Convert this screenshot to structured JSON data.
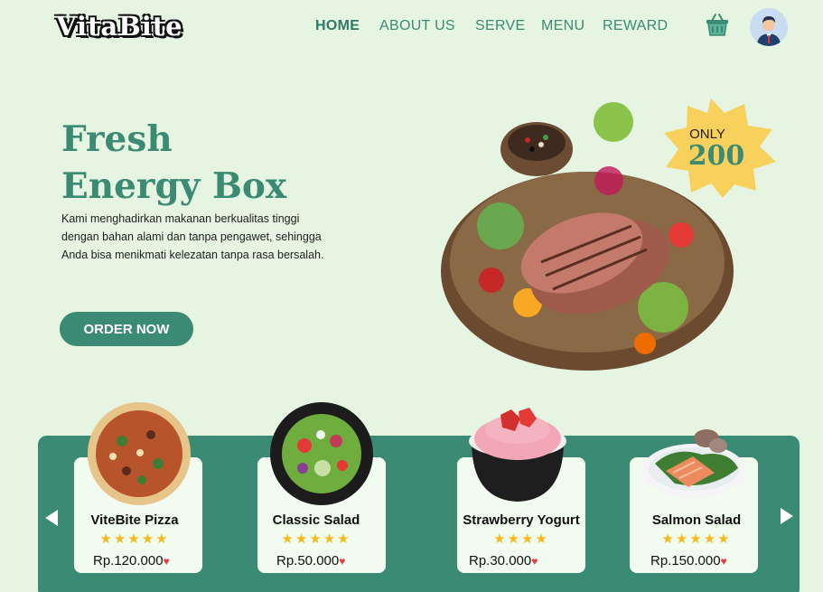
{
  "brand": {
    "logo_text": "VitaBite"
  },
  "nav": {
    "items": [
      "HOME",
      "ABOUT US",
      "SERVE",
      "MENU",
      "REWARD"
    ],
    "active": "HOME"
  },
  "icons": {
    "cart": "shopping-basket-icon",
    "user": "user-avatar-icon",
    "prev": "arrow-left-icon",
    "next": "arrow-right-icon",
    "heart": "heart-icon",
    "star": "star-icon"
  },
  "hero": {
    "title_line1": "Fresh",
    "title_line2": "Energy Box",
    "description": "Kami menghadirkan makanan berkualitas tinggi dengan bahan alami dan tanpa pengawet, sehingga Anda bisa menikmati kelezatan tanpa rasa bersalah.",
    "cta_label": "ORDER NOW",
    "badge_only": "ONLY",
    "badge_number": "200"
  },
  "products": [
    {
      "name": "ViteBite Pizza",
      "rating": 5,
      "stars": "★★★★★",
      "price": "Rp.120.000"
    },
    {
      "name": "Classic Salad",
      "rating": 5,
      "stars": "★★★★★",
      "price": "Rp.50.000"
    },
    {
      "name": "Strawberry Yogurt",
      "rating": 4,
      "stars": "★★★★",
      "price": "Rp.30.000"
    },
    {
      "name": "Salmon Salad",
      "rating": 5,
      "stars": "★★★★★",
      "price": "Rp.150.000"
    }
  ],
  "colors": {
    "background": "#e6f5e2",
    "primary": "#3b8a73",
    "card": "#f2fbef",
    "star": "#f6b91a",
    "heart": "#e53946",
    "badge": "#f7d15c"
  }
}
